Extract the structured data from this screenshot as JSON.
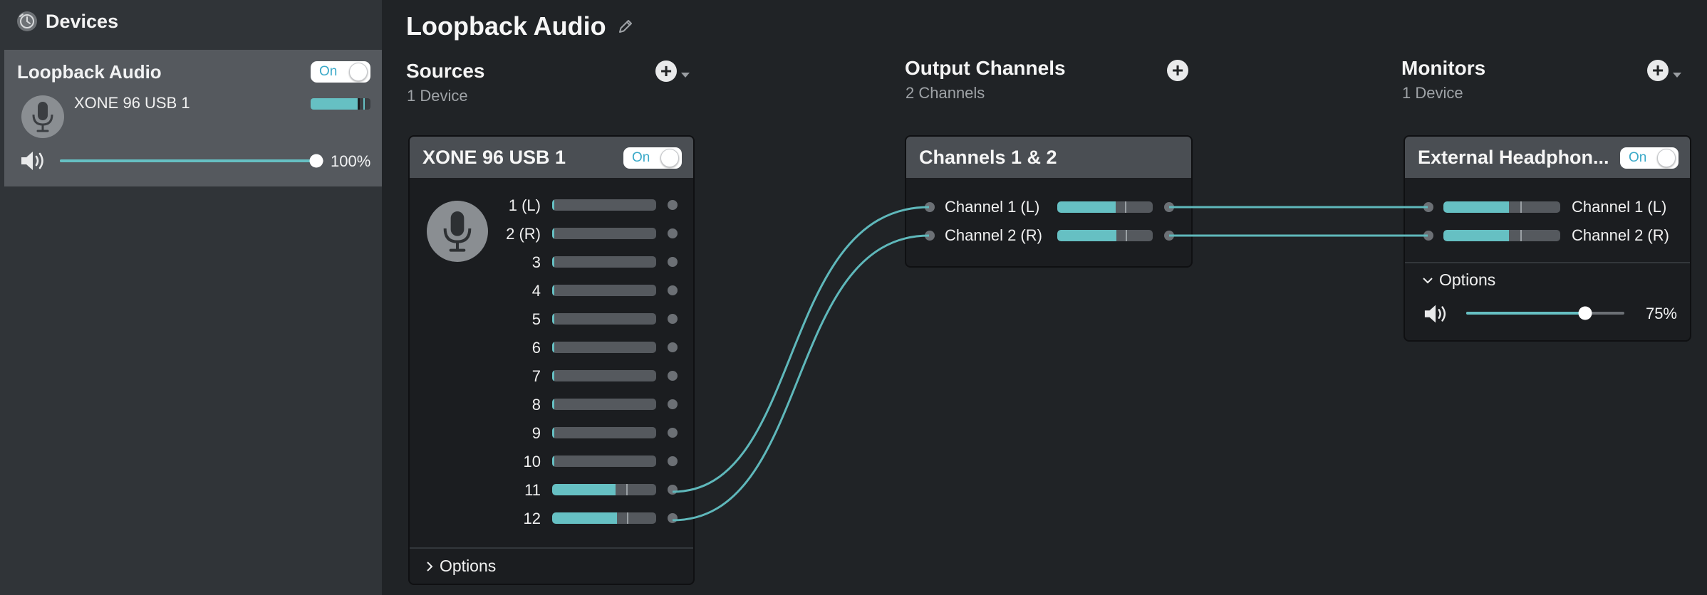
{
  "sidebar": {
    "title": "Devices",
    "card": {
      "name": "Loopback Audio",
      "toggle_label": "On",
      "device_name": "XONE 96 USB 1",
      "meter_level": 0.78,
      "volume_percent": 100,
      "volume_label": "100%"
    }
  },
  "main": {
    "title": "Loopback Audio"
  },
  "sources": {
    "title": "Sources",
    "subtitle": "1 Device",
    "add_label": "+",
    "panel": {
      "title": "XONE 96 USB 1",
      "toggle_label": "On",
      "channels": [
        {
          "label": "1 (L)",
          "level": 0.02,
          "peak": null
        },
        {
          "label": "2 (R)",
          "level": 0.02,
          "peak": null
        },
        {
          "label": "3",
          "level": 0.02,
          "peak": null
        },
        {
          "label": "4",
          "level": 0.02,
          "peak": null
        },
        {
          "label": "5",
          "level": 0.02,
          "peak": null
        },
        {
          "label": "6",
          "level": 0.02,
          "peak": null
        },
        {
          "label": "7",
          "level": 0.02,
          "peak": null
        },
        {
          "label": "8",
          "level": 0.02,
          "peak": null
        },
        {
          "label": "9",
          "level": 0.02,
          "peak": null
        },
        {
          "label": "10",
          "level": 0.02,
          "peak": null
        },
        {
          "label": "11",
          "level": 0.61,
          "peak": 0.71
        },
        {
          "label": "12",
          "level": 0.62,
          "peak": 0.72
        }
      ],
      "options_label": "Options"
    }
  },
  "output_channels": {
    "title": "Output Channels",
    "subtitle": "2 Channels",
    "add_label": "+",
    "panel": {
      "title": "Channels 1 & 2",
      "channels": [
        {
          "label": "Channel 1 (L)",
          "level": 0.61,
          "peak": 0.71
        },
        {
          "label": "Channel 2 (R)",
          "level": 0.62,
          "peak": 0.72
        }
      ]
    }
  },
  "monitors": {
    "title": "Monitors",
    "subtitle": "1 Device",
    "add_label": "+",
    "panel": {
      "title": "External Headphon...",
      "toggle_label": "On",
      "channels": [
        {
          "label": "Channel 1 (L)",
          "level": 0.56,
          "peak": 0.66
        },
        {
          "label": "Channel 2 (R)",
          "level": 0.56,
          "peak": 0.66
        }
      ],
      "options_label": "Options",
      "volume_percent": 75,
      "volume_label": "75%"
    }
  },
  "colors": {
    "accent": "#66c0c3",
    "toggle_text": "#3aa9c8",
    "wire": "#5fb8bb"
  },
  "icons": {
    "devices": "devices-clock-icon",
    "edit": "pencil-icon",
    "speaker": "speaker-volume-icon",
    "mic": "microphone-icon",
    "add": "plus-icon"
  }
}
